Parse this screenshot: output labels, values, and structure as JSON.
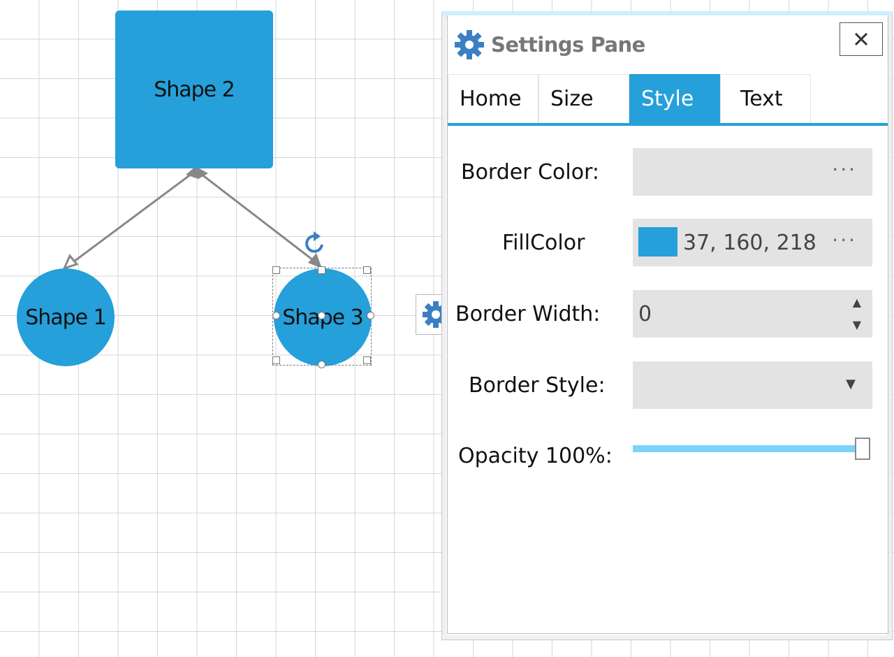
{
  "canvas": {
    "shapes": [
      {
        "label": "Shape 2"
      },
      {
        "label": "Shape 1"
      },
      {
        "label": "Shape 3"
      }
    ],
    "selected_shape": "Shape 3",
    "shape_fill": "#25a0da",
    "connector_color": "#888888"
  },
  "settings_pane": {
    "title": "Settings Pane",
    "close_icon": "close-icon",
    "header_icon": "gear-icon",
    "tabs": [
      {
        "label": "Home",
        "active": false
      },
      {
        "label": "Size",
        "active": false
      },
      {
        "label": "Style",
        "active": true
      },
      {
        "label": "Text",
        "active": false
      }
    ],
    "fields": {
      "border_color": {
        "label": "Border Color:",
        "value": "",
        "button": "..."
      },
      "fill_color": {
        "label": "FillColor",
        "value": "37, 160, 218",
        "swatch": "#25a0da",
        "button": "..."
      },
      "border_width": {
        "label": "Border Width:",
        "value": "0"
      },
      "border_style": {
        "label": "Border Style:",
        "value": ""
      },
      "opacity": {
        "label": "Opacity 100%:",
        "value": 1.0
      }
    },
    "accent": "#25a0da"
  }
}
